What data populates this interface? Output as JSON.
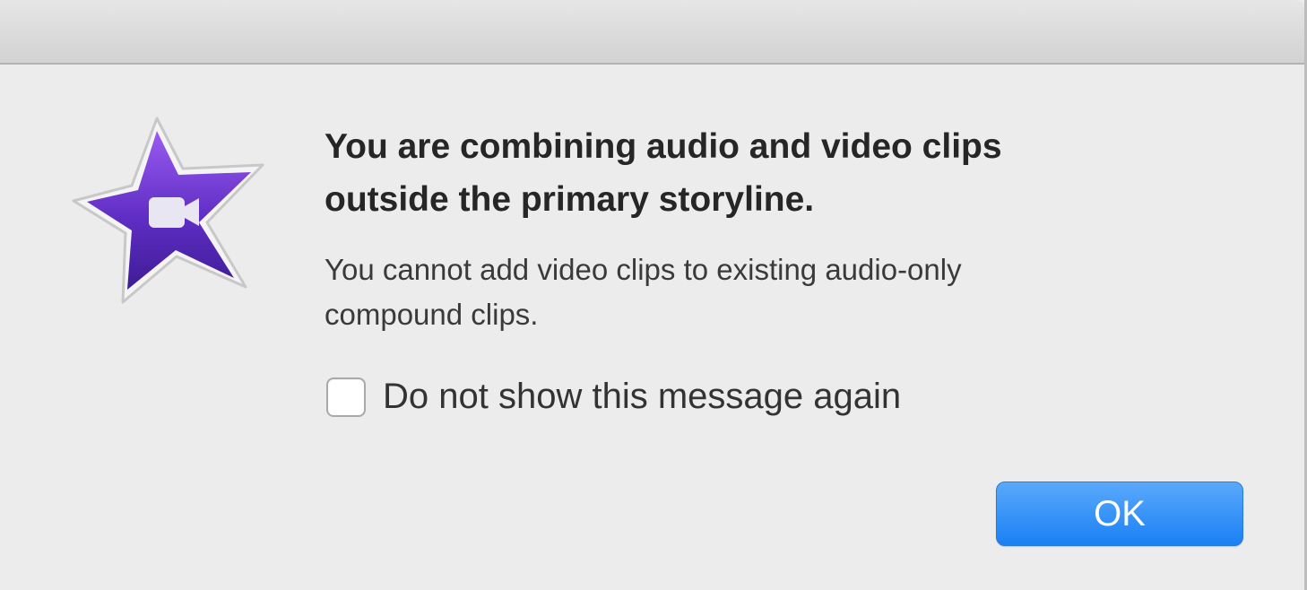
{
  "dialog": {
    "headline": "You are combining audio and video clips\noutside the primary storyline.",
    "message": "You cannot add video clips to existing audio-only\ncompound clips.",
    "checkbox_label": "Do not show this message again",
    "checkbox_checked": false,
    "ok_label": "OK",
    "app_icon": "imovie-star-icon"
  },
  "colors": {
    "accent": "#1a80f4",
    "star": "#5b2ab8"
  }
}
